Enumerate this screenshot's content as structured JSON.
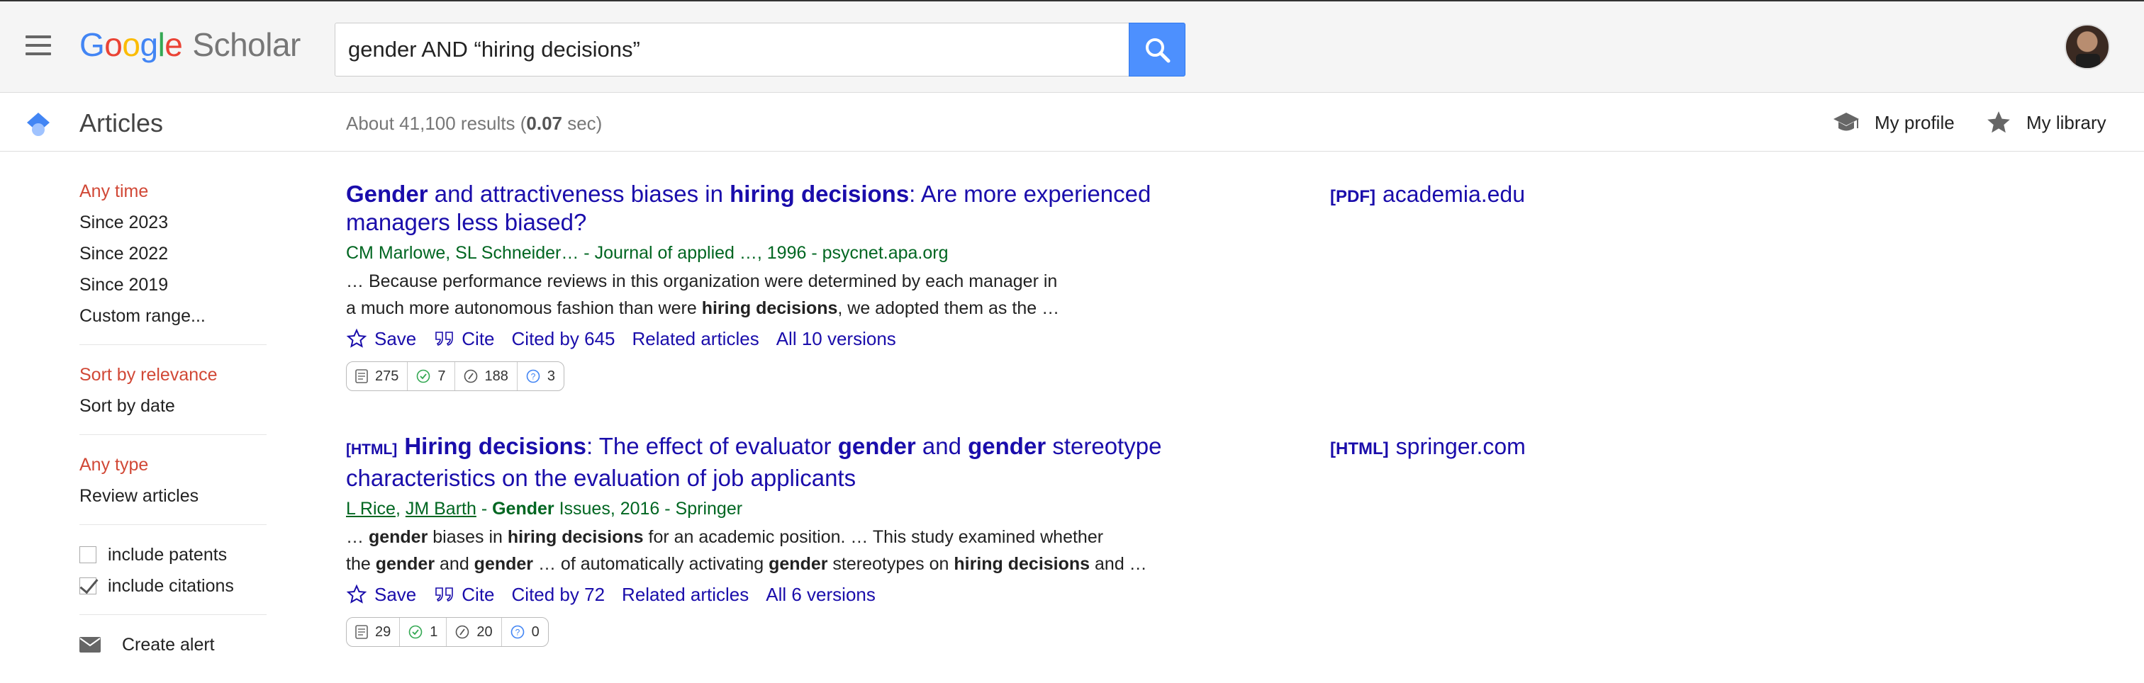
{
  "header": {
    "logo_letters": [
      "G",
      "o",
      "o",
      "g",
      "l",
      "e"
    ],
    "logo_scholar": "Scholar",
    "search_value": "gender AND “hiring decisions”",
    "icons": {
      "menu": "hamburger-menu-icon",
      "search": "search-icon",
      "avatar": "user-avatar"
    },
    "colors": {
      "search_button": "#4d90fe"
    }
  },
  "subbar": {
    "section_label": "Articles",
    "results_prefix": "About 41,100 results (",
    "results_time": "0.07",
    "results_suffix": " sec)",
    "my_profile": "My profile",
    "my_library": "My library"
  },
  "sidebar": {
    "time": [
      "Any time",
      "Since 2023",
      "Since 2022",
      "Since 2019",
      "Custom range..."
    ],
    "sort": [
      "Sort by relevance",
      "Sort by date"
    ],
    "type": [
      "Any type",
      "Review articles"
    ],
    "include_patents": "include patents",
    "include_patents_checked": false,
    "include_citations": "include citations",
    "include_citations_checked": true,
    "create_alert": "Create alert",
    "colors": {
      "active": "#d14836"
    }
  },
  "results": [
    {
      "tag": "",
      "title_parts": [
        {
          "text": "Gender",
          "bold": true
        },
        {
          "text": " and attractiveness biases in ",
          "bold": false
        },
        {
          "text": "hiring decisions",
          "bold": true
        },
        {
          "text": ": Are more experienced managers less biased?",
          "bold": false
        }
      ],
      "meta": "CM Marlowe, SL Schneider… - Journal of applied …, 1996 - psycnet.apa.org",
      "snippet_lines": [
        [
          {
            "text": "… Because performance reviews in this organization were determined by each manager in",
            "bold": false
          }
        ],
        [
          {
            "text": "a much more autonomous fashion than were ",
            "bold": false
          },
          {
            "text": "hiring decisions",
            "bold": true
          },
          {
            "text": ", we adopted them as the …",
            "bold": false
          }
        ]
      ],
      "actions": {
        "save": "Save",
        "cite": "Cite",
        "cited_by": "Cited by 645",
        "related": "Related articles",
        "versions": "All 10 versions"
      },
      "metrics": [
        "275",
        "7",
        "188",
        "3"
      ],
      "side_tag": "[PDF]",
      "side_domain": "academia.edu"
    },
    {
      "tag": "[HTML]",
      "title_parts": [
        {
          "text": "Hiring decisions",
          "bold": true
        },
        {
          "text": ": The effect of evaluator ",
          "bold": false
        },
        {
          "text": "gender",
          "bold": true
        },
        {
          "text": " and ",
          "bold": false
        },
        {
          "text": "gender",
          "bold": true
        },
        {
          "text": " stereotype characteristics on the evaluation of job applicants",
          "bold": false
        }
      ],
      "meta_authors": [
        "L Rice",
        "JM Barth"
      ],
      "meta_separator": " - ",
      "meta_source_bold": "Gender",
      "meta_source_rest": " Issues, 2016 - Springer",
      "snippet_lines": [
        [
          {
            "text": "… ",
            "bold": false
          },
          {
            "text": "gender",
            "bold": true
          },
          {
            "text": " biases in ",
            "bold": false
          },
          {
            "text": "hiring decisions",
            "bold": true
          },
          {
            "text": " for an academic position. … This study examined whether",
            "bold": false
          }
        ],
        [
          {
            "text": "the ",
            "bold": false
          },
          {
            "text": "gender",
            "bold": true
          },
          {
            "text": " and ",
            "bold": false
          },
          {
            "text": "gender",
            "bold": true
          },
          {
            "text": " … of automatically activating ",
            "bold": false
          },
          {
            "text": "gender",
            "bold": true
          },
          {
            "text": " stereotypes on ",
            "bold": false
          },
          {
            "text": "hiring decisions",
            "bold": true
          },
          {
            "text": " and …",
            "bold": false
          }
        ]
      ],
      "actions": {
        "save": "Save",
        "cite": "Cite",
        "cited_by": "Cited by 72",
        "related": "Related articles",
        "versions": "All 6 versions"
      },
      "metrics": [
        "29",
        "1",
        "20",
        "0"
      ],
      "side_tag": "[HTML]",
      "side_domain": "springer.com"
    }
  ]
}
